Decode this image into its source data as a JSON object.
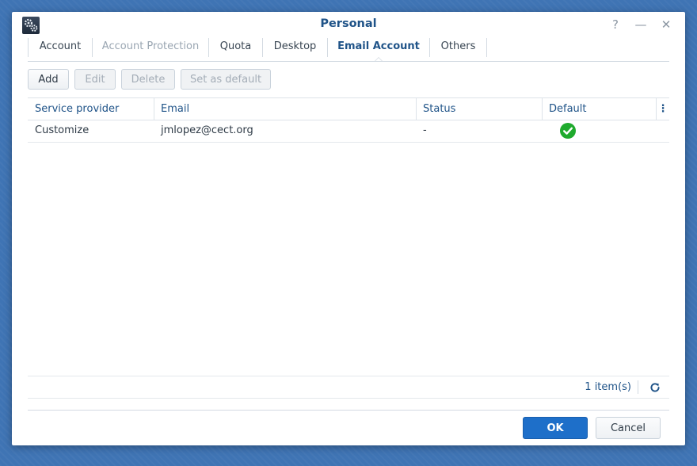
{
  "window": {
    "title": "Personal",
    "help_glyph": "?",
    "minimize_glyph": "—",
    "close_glyph": "✕"
  },
  "tabs": [
    {
      "label": "Account",
      "state": "normal"
    },
    {
      "label": "Account Protection",
      "state": "disabled"
    },
    {
      "label": "Quota",
      "state": "normal"
    },
    {
      "label": "Desktop",
      "state": "normal"
    },
    {
      "label": "Email Account",
      "state": "active"
    },
    {
      "label": "Others",
      "state": "normal"
    }
  ],
  "toolbar": {
    "add_label": "Add",
    "edit_label": "Edit",
    "delete_label": "Delete",
    "set_default_label": "Set as default"
  },
  "grid": {
    "columns": [
      "Service provider",
      "Email",
      "Status",
      "Default"
    ],
    "rows": [
      {
        "service_provider": "Customize",
        "email": "jmlopez@cect.org",
        "status": "-",
        "default": true
      }
    ],
    "more_glyph": "⋮"
  },
  "footer": {
    "count_label": "1 item(s)"
  },
  "dialog_buttons": {
    "ok_label": "OK",
    "cancel_label": "Cancel"
  },
  "colors": {
    "accent": "#1f5388",
    "primary_button": "#1e6fc9",
    "check_green": "#1faa2d",
    "desktop_background": "#3f74b4"
  }
}
